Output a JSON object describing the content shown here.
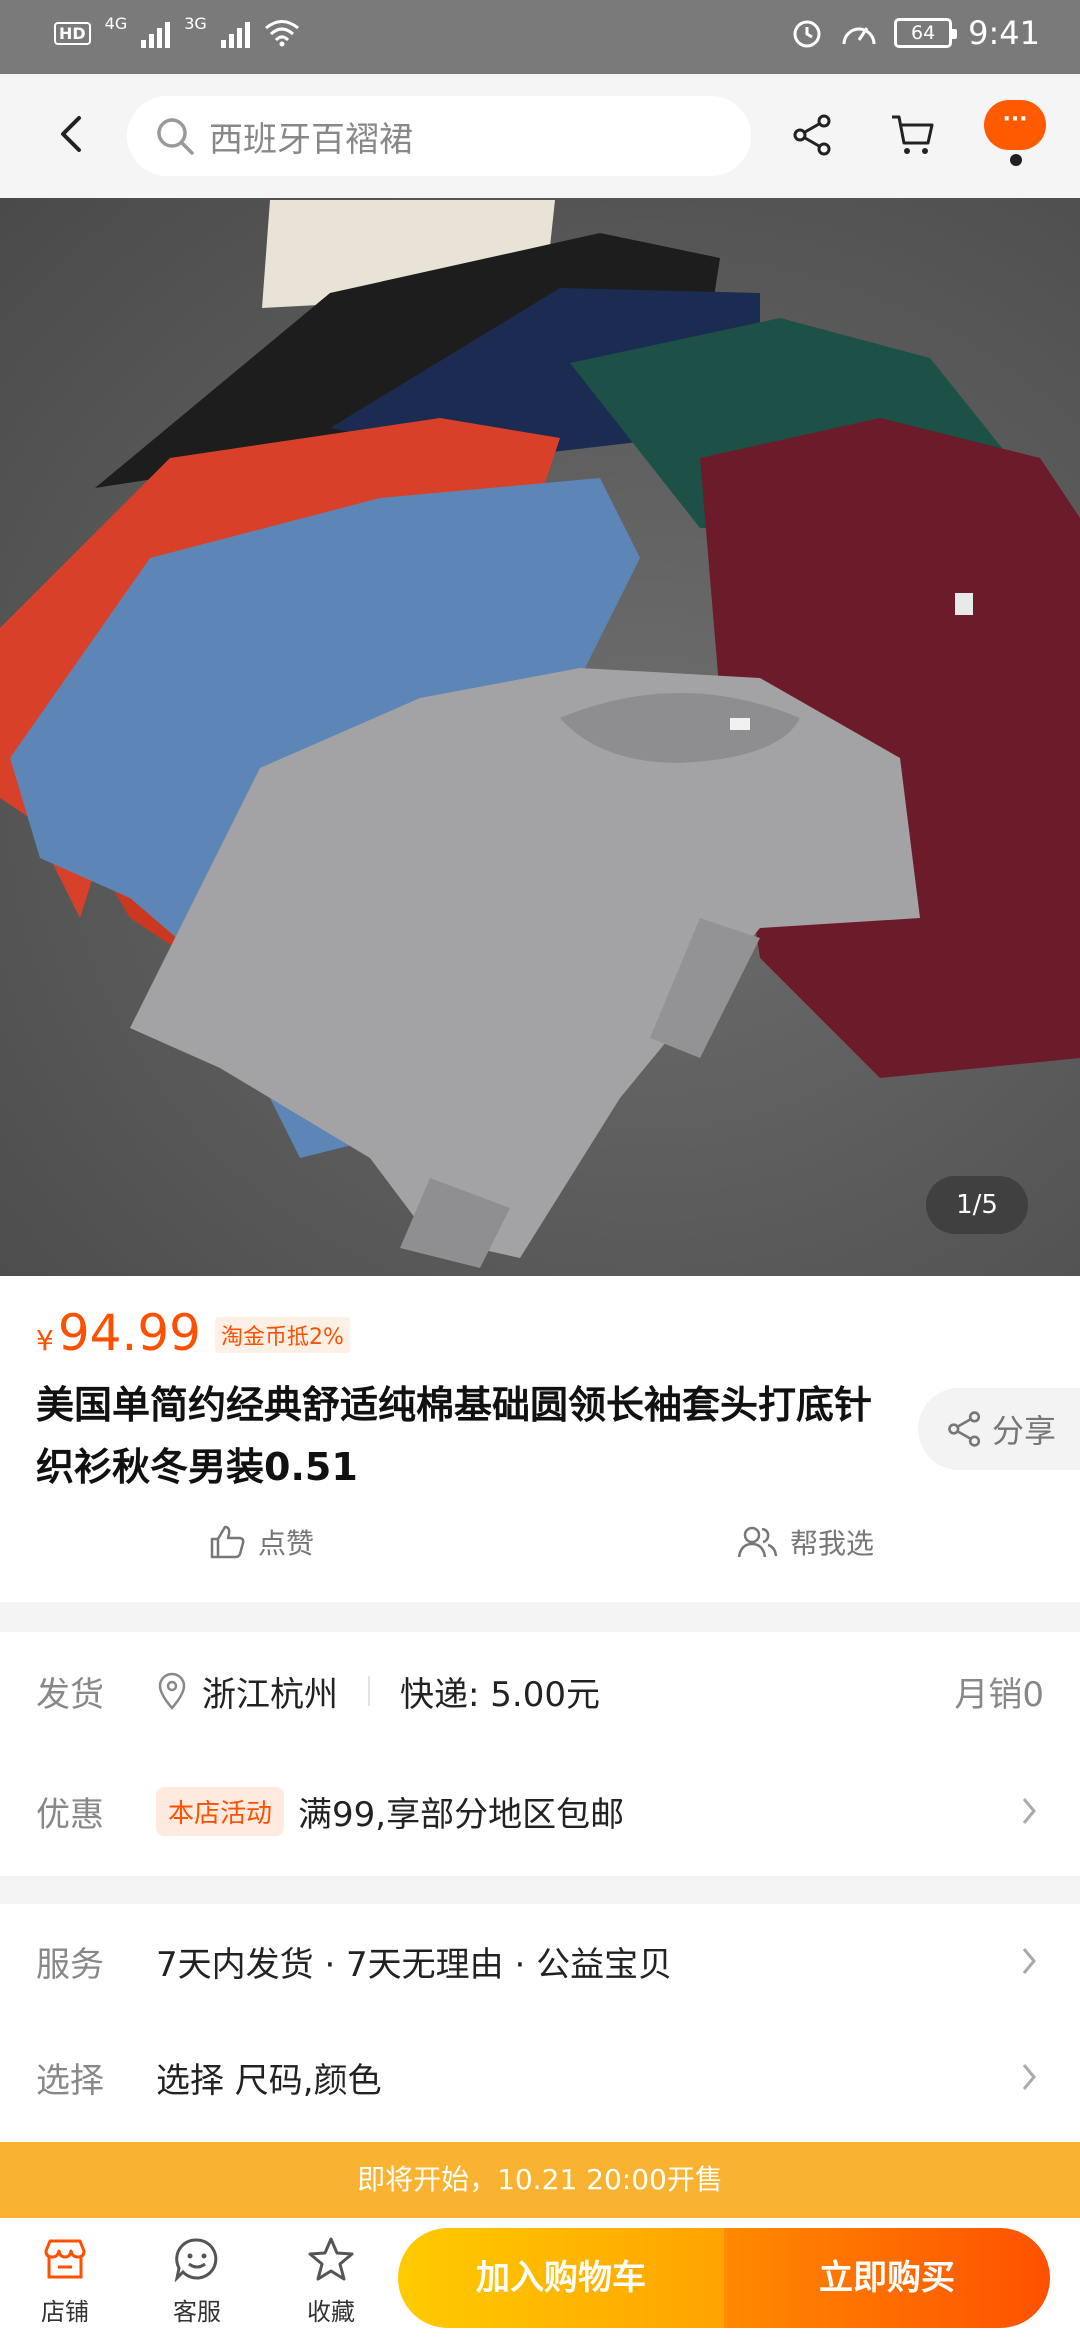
{
  "status_bar": {
    "time": "9:41",
    "battery": "64",
    "hd": "HD",
    "net1": "4G",
    "net2": "3G"
  },
  "nav": {
    "search_placeholder": "西班牙百褶裙",
    "more_label": "···"
  },
  "gallery": {
    "counter": "1/5"
  },
  "product": {
    "currency": "¥",
    "price": "94.99",
    "coin_badge": "淘金币抵2%",
    "title": "美国单简约经典舒适纯棉基础圆领长袖套头打底针织衫秋冬男装0.51",
    "share_label": "分享",
    "like_label": "点赞",
    "pick_label": "帮我选"
  },
  "delivery": {
    "label": "发货",
    "location": "浙江杭州",
    "shipping": "快递: 5.00元",
    "sales": "月销0"
  },
  "promo": {
    "label": "优惠",
    "tag": "本店活动",
    "text": "满99,享部分地区包邮"
  },
  "service": {
    "label": "服务",
    "text": "7天内发货 · 7天无理由 · 公益宝贝"
  },
  "select": {
    "label": "选择",
    "text": "选择 尺码,颜色"
  },
  "sale_banner": "即将开始，10.21 20:00开售",
  "bottom": {
    "shop": "店铺",
    "service": "客服",
    "favorite": "收藏",
    "add_cart": "加入购物车",
    "buy_now": "立即购买"
  },
  "colors": {
    "accent": "#ff5000",
    "cart_gradient": "#ffcb00",
    "banner": "#f9b330"
  }
}
